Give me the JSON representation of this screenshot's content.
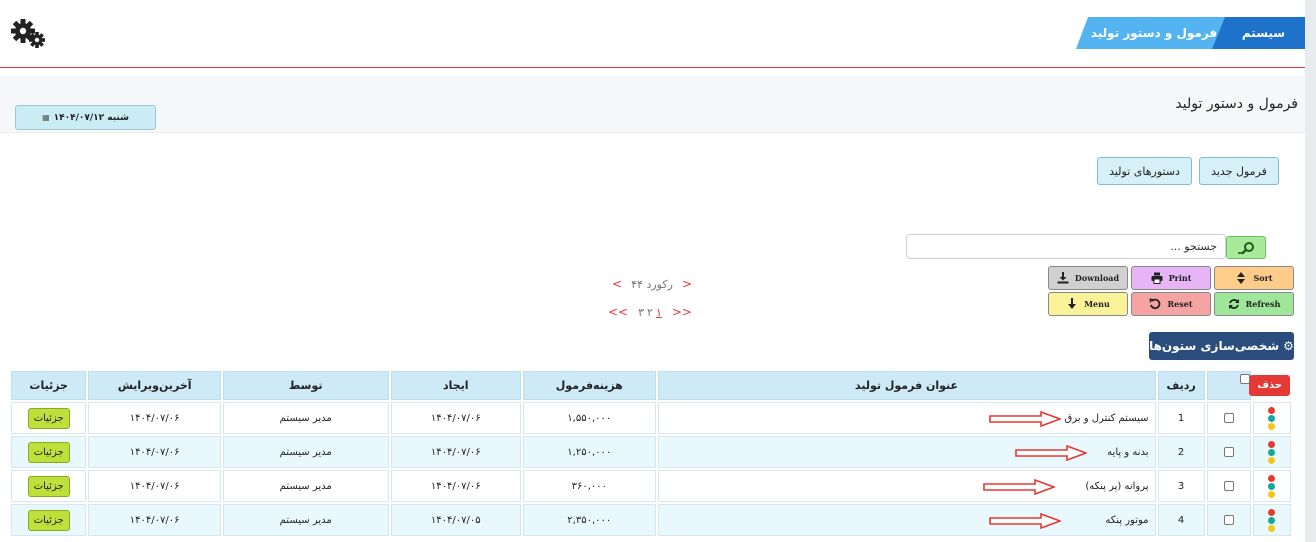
{
  "header": {
    "crumb_main": "سیستم",
    "crumb_sub": "فرمول و دستور تولید"
  },
  "page": {
    "title": "فرمول و دستور تولید",
    "date_text": "شنبه ۱۴۰۴/۰۷/۱۲"
  },
  "actions": {
    "new_formula": "فرمول جدید",
    "production_orders": "دستورهای تولید"
  },
  "search": {
    "placeholder": "جستجو ..."
  },
  "toolbar": {
    "sort": "Sort",
    "print": "Print",
    "download": "Download",
    "refresh": "Refresh",
    "reset": "Reset",
    "menu": "Menu"
  },
  "pager": {
    "record_count": "۴۴ رکورد",
    "pages": [
      "۱",
      "۲",
      "۳"
    ],
    "first": "<<",
    "last": ">>",
    "prev": "<",
    "next": ">"
  },
  "customize_label": "شخصی‌سازی ستون‌ها",
  "table": {
    "headers": {
      "delete": "حذف",
      "row": "ردیف",
      "title": "عنوان فرمول تولید",
      "cost": "هزینه‌فرمول",
      "created": "ایجاد",
      "by": "توسط",
      "last_edit": "آخرین‌ویرایش",
      "details": "جزئیات"
    },
    "rows": [
      {
        "no": "1",
        "title": "سیستم کنترل و برق",
        "cost": "۱,۵۵۰,۰۰۰",
        "created": "۱۴۰۴/۰۷/۰۶",
        "by": "مدیر سیستم",
        "last_edit": "۱۴۰۴/۰۷/۰۶",
        "details": "جزئیات"
      },
      {
        "no": "2",
        "title": "بدنه و پایه",
        "cost": "۱,۲۵۰,۰۰۰",
        "created": "۱۴۰۴/۰۷/۰۶",
        "by": "مدیر سیستم",
        "last_edit": "۱۴۰۴/۰۷/۰۶",
        "details": "جزئیات"
      },
      {
        "no": "3",
        "title": "پروانه (پر پنکه)",
        "cost": "۳۶۰,۰۰۰",
        "created": "۱۴۰۴/۰۷/۰۶",
        "by": "مدیر سیستم",
        "last_edit": "۱۴۰۴/۰۷/۰۶",
        "details": "جزئیات"
      },
      {
        "no": "4",
        "title": "موتور پنکه",
        "cost": "۲,۳۵۰,۰۰۰",
        "created": "۱۴۰۴/۰۷/۰۵",
        "by": "مدیر سیستم",
        "last_edit": "۱۴۰۴/۰۷/۰۶",
        "details": "جزئیات"
      }
    ]
  },
  "colors": {
    "accent_blue": "#1f72c9",
    "light_blue": "#54b4f2",
    "delete_red": "#e53935",
    "details_green": "#bde03a",
    "status_dots": [
      "#e53935",
      "#12a89a",
      "#f5c518"
    ]
  }
}
